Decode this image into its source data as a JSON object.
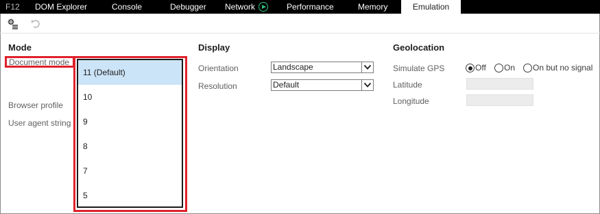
{
  "tabs": [
    {
      "label": "F12"
    },
    {
      "label": "DOM Explorer"
    },
    {
      "label": "Console"
    },
    {
      "label": "Debugger"
    },
    {
      "label": "Network"
    },
    {
      "label": "Performance"
    },
    {
      "label": "Memory"
    },
    {
      "label": "Emulation"
    }
  ],
  "active_tab": "Emulation",
  "toolbar": {
    "icons": [
      "settings-list-icon",
      "undo-icon"
    ]
  },
  "mode": {
    "title": "Mode",
    "document_mode_label": "Document mode",
    "browser_profile_label": "Browser profile",
    "user_agent_label": "User agent string",
    "document_mode_options": [
      "11 (Default)",
      "10",
      "9",
      "8",
      "7",
      "5"
    ],
    "selected_option": "11 (Default)"
  },
  "display": {
    "title": "Display",
    "orientation_label": "Orientation",
    "orientation_value": "Landscape",
    "resolution_label": "Resolution",
    "resolution_value": "Default"
  },
  "geolocation": {
    "title": "Geolocation",
    "simulate_gps_label": "Simulate GPS",
    "gps_options": [
      "Off",
      "On",
      "On but no signal"
    ],
    "gps_selected": "Off",
    "latitude_label": "Latitude",
    "longitude_label": "Longitude",
    "latitude_value": "",
    "longitude_value": ""
  },
  "colors": {
    "highlight": "#e0202a",
    "selected_item_bg": "#cce4f7",
    "tabbar_bg": "#000000",
    "network_play_icon": "#2ec27e"
  }
}
